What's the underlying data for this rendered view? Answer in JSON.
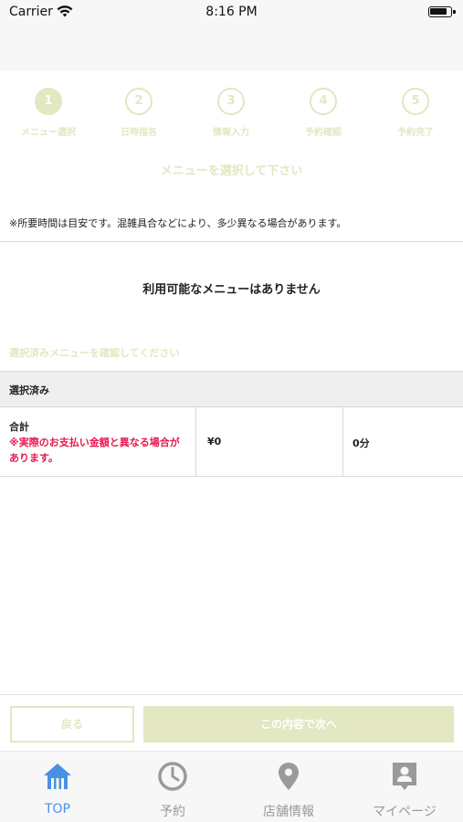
{
  "status_bar": {
    "carrier": "Carrier",
    "time": "8:16 PM"
  },
  "steps": [
    {
      "number": "1",
      "label": "メニュー選択",
      "active": true
    },
    {
      "number": "2",
      "label": "日時指名",
      "active": false
    },
    {
      "number": "3",
      "label": "情報入力",
      "active": false
    },
    {
      "number": "4",
      "label": "予約確認",
      "active": false
    },
    {
      "number": "5",
      "label": "予約完了",
      "active": false
    }
  ],
  "section_title": "メニューを選択して下さい",
  "note": "※所要時間は目安です。混雑具合などにより、多少異なる場合があります。",
  "empty_message": "利用可能なメニューはありません",
  "confirm_label": "選択済みメニューを確認してください",
  "selected": {
    "header": "選択済み",
    "total_label": "合計",
    "total_warning": "※実際のお支払い金額と異なる場合があります。",
    "total_price": "¥0",
    "total_time": "0分"
  },
  "buttons": {
    "back": "戻る",
    "next": "この内容で次へ"
  },
  "tabs": [
    {
      "label": "TOP",
      "icon": "home-icon",
      "active": true
    },
    {
      "label": "予約",
      "icon": "clock-icon",
      "active": false
    },
    {
      "label": "店舗情報",
      "icon": "map-pin-icon",
      "active": false
    },
    {
      "label": "マイページ",
      "icon": "profile-icon",
      "active": false
    }
  ],
  "colors": {
    "accent": "#e3e7c2",
    "active_tab": "#4a90e2",
    "warning": "#e8184d"
  }
}
